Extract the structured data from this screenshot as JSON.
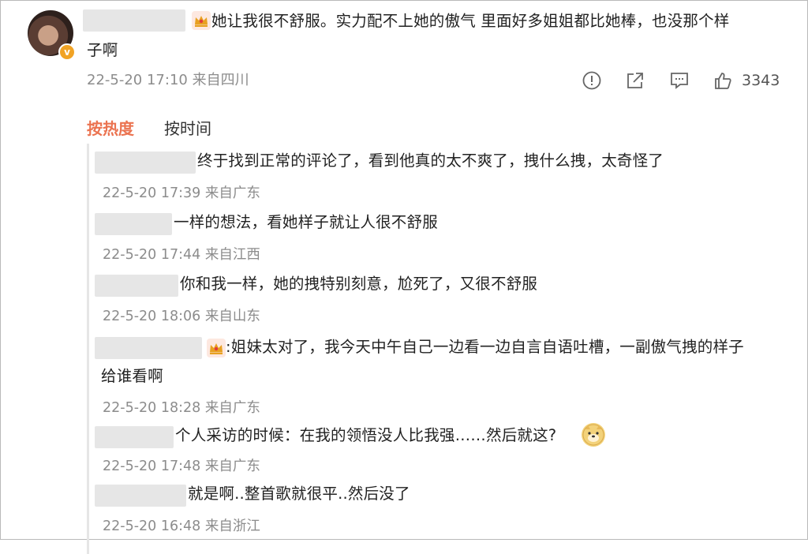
{
  "post": {
    "username_masked": "",
    "text_line1": "她让我很不舒服。实力配不上她的傲气 里面好多姐姐都比她棒，也没那个样",
    "text_line2": "子啊",
    "meta": "22-5-20 17:10 来自四川",
    "like_count": "3343",
    "icons": [
      "report-icon",
      "share-icon",
      "comment-icon",
      "like-icon"
    ]
  },
  "tabs": {
    "hot": "按热度",
    "time": "按时间",
    "active": "hot"
  },
  "replies": [
    {
      "text": "终于找到正常的评论了，看到他真的太不爽了，拽什么拽，太奇怪了",
      "meta": "22-5-20 17:39 来自广东"
    },
    {
      "text": "一样的想法，看她样子就让人很不舒服",
      "meta": "22-5-20 17:44 来自江西"
    },
    {
      "text": "你和我一样，她的拽特别刻意，尬死了，又很不舒服",
      "meta": "22-5-20 18:06 来自山东"
    },
    {
      "text_line1": ":姐妹太对了，我今天中午自己一边看一边自言自语吐槽，一副傲气拽的样子",
      "text_line2": "给谁看啊",
      "meta": "22-5-20 18:28 来自广东"
    },
    {
      "text": "个人采访的时候：在我的领悟没人比我强……然后就这?",
      "meta": "22-5-20 17:48 来自广东"
    },
    {
      "text": "就是啊..整首歌就很平..然后没了",
      "meta": "22-5-20 16:48 来自浙江"
    }
  ],
  "colors": {
    "accent": "#eb7350",
    "meta_text": "#8c8c8c",
    "mask": "#e6e6e6"
  }
}
